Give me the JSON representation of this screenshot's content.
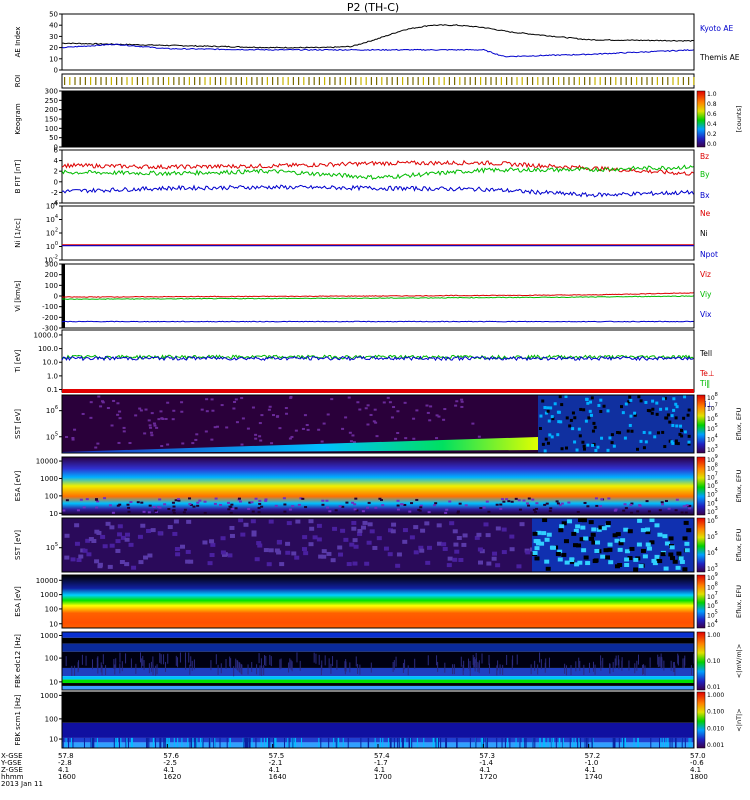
{
  "chart_data": [
    {
      "type": "line",
      "title": "P2 (TH-C)",
      "ylabel": "AE Index",
      "yticks": [
        "50",
        "40",
        "30",
        "20",
        "10",
        "0"
      ],
      "ylim": [
        0,
        50
      ],
      "legend_placement": "right",
      "series": [
        {
          "name": "Kyoto AE",
          "color": "#000000",
          "x": [
            1600,
            1620,
            1640,
            1650,
            1655,
            1700,
            1705,
            1710,
            1715,
            1720,
            1725,
            1740,
            1800
          ],
          "y": [
            24,
            22,
            20,
            20,
            21,
            28,
            36,
            40,
            40,
            38,
            34,
            27,
            26
          ]
        },
        {
          "name": "Themis AE",
          "color": "#0000cc",
          "x": [
            1600,
            1610,
            1620,
            1640,
            1700,
            1720,
            1724,
            1740,
            1800
          ],
          "y": [
            20,
            23,
            19,
            18,
            18,
            18,
            12,
            14,
            18
          ]
        }
      ]
    },
    {
      "type": "heatmap",
      "ylabel": "ROI"
    },
    {
      "type": "heatmap",
      "ylabel": "Keogram",
      "yticks": [
        "300",
        "250",
        "200",
        "150",
        "100",
        "50",
        "0"
      ],
      "colorbar": {
        "label": "[counts]",
        "ticks": [
          "1.0",
          "0.8",
          "0.6",
          "0.4",
          "0.2",
          "0.0"
        ]
      }
    },
    {
      "type": "line",
      "ylabel": "B FIT [nT]",
      "yticks": [
        "6",
        "4",
        "2",
        "0",
        "-2",
        "-4"
      ],
      "ylim": [
        -4,
        6
      ],
      "series": [
        {
          "name": "Bz",
          "color": "#dd0000",
          "x": [
            1600,
            1620,
            1640,
            1700,
            1720,
            1740,
            1800
          ],
          "y": [
            3.1,
            2.8,
            3.0,
            3.5,
            3.6,
            2.6,
            1.5
          ]
        },
        {
          "name": "By",
          "color": "#00bb00",
          "x": [
            1600,
            1620,
            1640,
            1700,
            1720,
            1740,
            1800
          ],
          "y": [
            1.8,
            1.6,
            2.0,
            0.8,
            2.2,
            2.3,
            2.8
          ]
        },
        {
          "name": "Bx",
          "color": "#0000cc",
          "x": [
            1600,
            1620,
            1640,
            1700,
            1720,
            1740,
            1800
          ],
          "y": [
            -1.8,
            -1.2,
            -1.0,
            -1.2,
            -1.4,
            -2.5,
            -2.0
          ]
        }
      ]
    },
    {
      "type": "line",
      "ylabel": "Ni [1/cc]",
      "yticks": [
        "10^6",
        "10^4",
        "10^2",
        "10^0",
        "10^-2"
      ],
      "legend": [
        "Ne",
        "Ni",
        "Npot"
      ],
      "legend_colors": [
        "#dd0000",
        "#000000",
        "#0000cc"
      ],
      "series": [
        {
          "name": "Ne",
          "color": "#dd0000",
          "x": [
            1600,
            1800
          ],
          "y": [
            0.3,
            0.3
          ]
        },
        {
          "name": "Npot",
          "color": "#0000cc",
          "x": [
            1600,
            1800
          ],
          "y": [
            0.3,
            0.3
          ]
        }
      ]
    },
    {
      "type": "line",
      "ylabel": "Vi [km/s]",
      "yticks": [
        "300",
        "200",
        "100",
        "0",
        "-100",
        "-200",
        "-300"
      ],
      "ylim": [
        -300,
        300
      ],
      "series": [
        {
          "name": "Viz",
          "color": "#dd0000",
          "x": [
            1600,
            1700,
            1740,
            1800
          ],
          "y": [
            -10,
            0,
            10,
            30
          ]
        },
        {
          "name": "Viy",
          "color": "#00bb00",
          "x": [
            1600,
            1700,
            1740,
            1800
          ],
          "y": [
            -30,
            -20,
            -10,
            0
          ]
        },
        {
          "name": "Vix",
          "color": "#0000cc",
          "x": [
            1600,
            1700,
            1740,
            1800
          ],
          "y": [
            -240,
            -240,
            -240,
            -240
          ]
        }
      ]
    },
    {
      "type": "line",
      "ylabel": "Ti [eV]",
      "yticks": [
        "1000.0",
        "100.0",
        "10.0",
        "1.0",
        "0.1"
      ],
      "legend": [
        "Tell",
        "Te⊥",
        "Ti‖",
        "Ti⊥"
      ],
      "legend_colors": [
        "#000000",
        "#dd0000",
        "#00bb00",
        "#0000cc"
      ],
      "series": [
        {
          "name": "Ti‖",
          "color": "#00bb00",
          "x": [
            1600,
            1700,
            1740,
            1800
          ],
          "y": [
            20,
            25,
            15,
            30
          ]
        },
        {
          "name": "Ti⊥",
          "color": "#0000cc",
          "x": [
            1600,
            1700,
            1740,
            1800
          ],
          "y": [
            15,
            20,
            25,
            30
          ]
        }
      ]
    },
    {
      "type": "heatmap",
      "ylabel": "SST [eV]",
      "yticks": [
        "10^6",
        "10^5"
      ],
      "colorbar": {
        "label": "Eflux, EFU",
        "ticks": [
          "10^8",
          "10^7",
          "10^6",
          "10^5",
          "10^4",
          "10^3"
        ]
      }
    },
    {
      "type": "heatmap",
      "ylabel": "ESA [eV]",
      "yticks": [
        "10000",
        "1000",
        "100",
        "10"
      ],
      "colorbar": {
        "label": "Eflux, EFU",
        "ticks": [
          "10^9",
          "10^8",
          "10^7",
          "10^6",
          "10^5",
          "10^4",
          "10^3"
        ]
      }
    },
    {
      "type": "heatmap",
      "ylabel": "SST [eV]",
      "yticks": [
        "10^5"
      ],
      "colorbar": {
        "label": "Eflux, EFU",
        "ticks": [
          "10^6",
          "10^5",
          "10^4",
          "10^3"
        ]
      }
    },
    {
      "type": "heatmap",
      "ylabel": "ESA [eV]",
      "yticks": [
        "10000",
        "1000",
        "100",
        "10"
      ],
      "colorbar": {
        "label": "Eflux, EFU",
        "ticks": [
          "10^9",
          "10^8",
          "10^7",
          "10^6",
          "10^5",
          "10^4"
        ]
      }
    },
    {
      "type": "heatmap",
      "ylabel": "FBK edc12 [Hz]",
      "yticks": [
        "1000",
        "100",
        "10"
      ],
      "colorbar": {
        "label": "<|mV/m|>",
        "ticks": [
          "1.00",
          "0.10",
          "0.01"
        ]
      }
    },
    {
      "type": "heatmap",
      "ylabel": "FBK scm1 [Hz]",
      "yticks": [
        "1000",
        "100",
        "10"
      ],
      "colorbar": {
        "label": "<|nT|>",
        "ticks": [
          "1.000",
          "0.100",
          "0.010",
          "0.001"
        ]
      }
    }
  ],
  "xaxis": {
    "row_labels": [
      "X-GSE",
      "Y-GSE",
      "Z-GSE",
      "hhmm",
      "2013 Jan 11"
    ],
    "columns": [
      [
        "57.8",
        "-2.8",
        "4.1",
        "1600"
      ],
      [
        "57.6",
        "-2.5",
        "4.1",
        "1620"
      ],
      [
        "57.5",
        "-2.1",
        "4.1",
        "1640"
      ],
      [
        "57.4",
        "-1.7",
        "4.1",
        "1700"
      ],
      [
        "57.3",
        "-1.4",
        "4.1",
        "1720"
      ],
      [
        "57.2",
        "-1.0",
        "4.1",
        "1740"
      ],
      [
        "57.0",
        "-0.6",
        "4.1",
        "1800"
      ]
    ]
  },
  "colors": {
    "red": "#dd0000",
    "green": "#00bb00",
    "blue": "#0000cc",
    "panel_bg": "#000000"
  }
}
